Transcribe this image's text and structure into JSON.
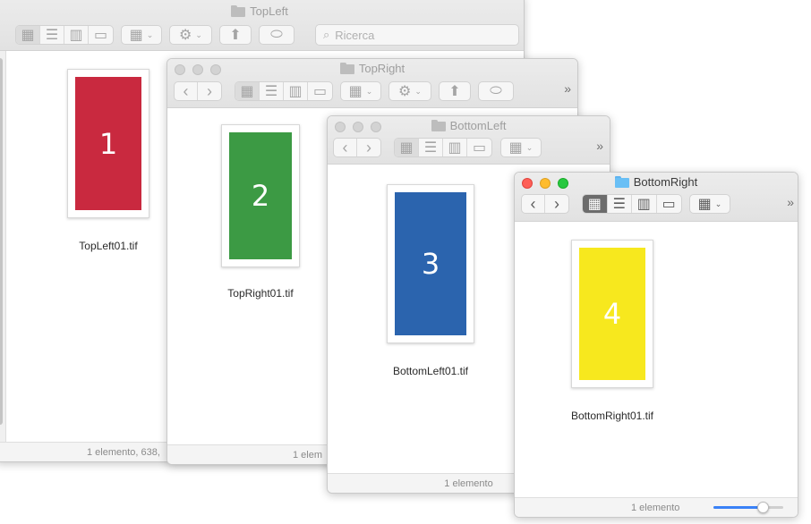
{
  "windows": {
    "top_left": {
      "title": "TopLeft",
      "search_placeholder": "Ricerca",
      "file_name": "TopLeft01.tif",
      "thumb_number": "1",
      "thumb_color": "#c9293f",
      "status": "1 elemento, 638,"
    },
    "top_right": {
      "title": "TopRight",
      "file_name": "TopRight01.tif",
      "thumb_number": "2",
      "thumb_color": "#3c9a44",
      "status": "1 elem"
    },
    "bottom_left": {
      "title": "BottomLeft",
      "file_name": "BottomLeft01.tif",
      "thumb_number": "3",
      "thumb_color": "#2b64ae",
      "status": "1 elemento"
    },
    "bottom_right": {
      "title": "BottomRight",
      "file_name": "BottomRight01.tif",
      "thumb_number": "4",
      "thumb_color": "#f7e81e",
      "status": "1 elemento",
      "icon_size_level": 0.7
    }
  },
  "icons": {
    "more_toolbar": "»",
    "back": "‹",
    "forward": "›",
    "gear": "⚙",
    "share": "⬆",
    "search": "⌕"
  }
}
